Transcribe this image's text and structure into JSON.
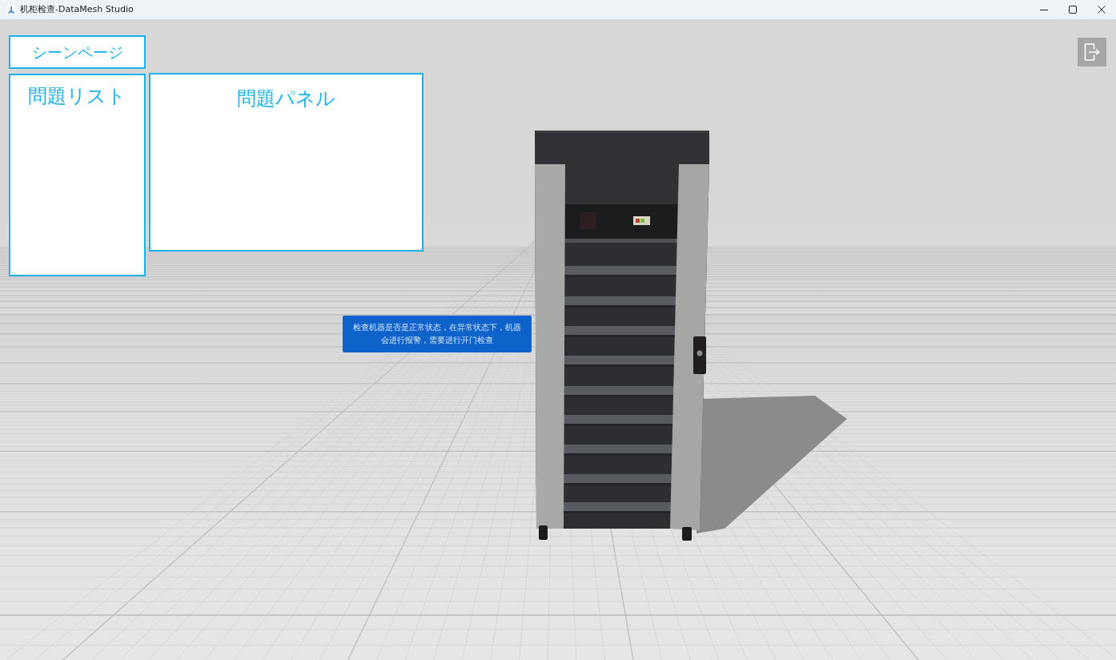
{
  "window": {
    "title": "机柜检查-DataMesh Studio"
  },
  "scene_page_button": {
    "label": "シーンページ"
  },
  "problem_list": {
    "title": "問題リスト"
  },
  "problem_panel": {
    "title": "問題パネル"
  },
  "scene": {
    "info_label": "检查机器是否是正常状态，在异常状态下，机器会进行报警，需要进行开门检查"
  }
}
